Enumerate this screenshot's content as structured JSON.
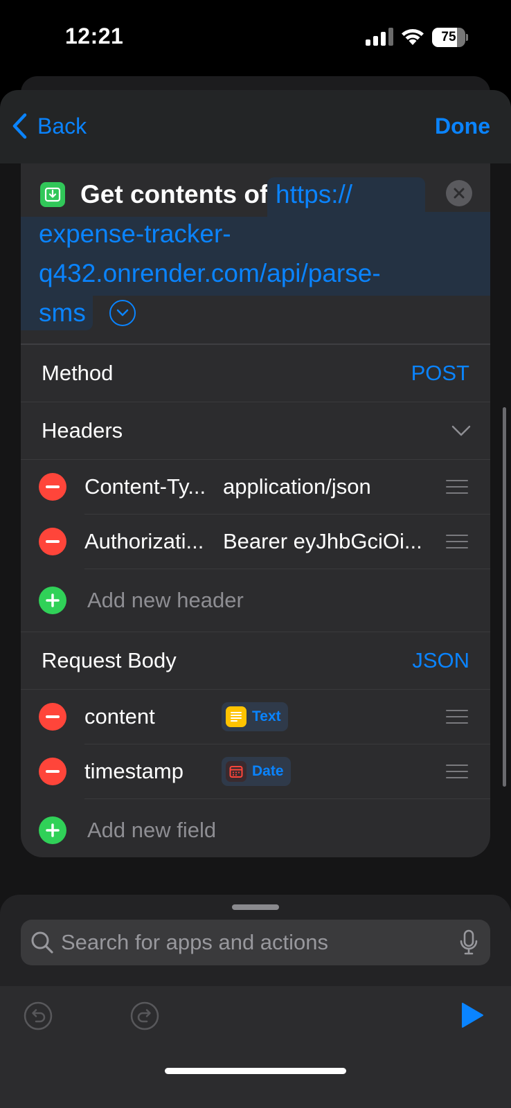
{
  "status_bar": {
    "time": "12:21",
    "battery_level": "75"
  },
  "nav": {
    "back_label": "Back",
    "done_label": "Done"
  },
  "action": {
    "title": "Get contents of",
    "url_lines": [
      "https://",
      "expense-tracker-",
      "q432.onrender.com/api/parse-",
      "sms"
    ]
  },
  "method": {
    "label": "Method",
    "value": "POST"
  },
  "headers": {
    "label": "Headers",
    "items": [
      {
        "key": "Content-Ty...",
        "value": "application/json"
      },
      {
        "key": "Authorizati...",
        "value": "Bearer eyJhbGciOi..."
      }
    ],
    "add_label": "Add new header"
  },
  "request_body": {
    "label": "Request Body",
    "type": "JSON",
    "fields": [
      {
        "key": "content",
        "variable": "Text",
        "variable_icon": "text-variable-icon",
        "icon_color": "#ffc300"
      },
      {
        "key": "timestamp",
        "variable": "Date",
        "variable_icon": "calendar-icon",
        "icon_color": "#ff453a"
      }
    ],
    "add_label": "Add new field"
  },
  "search": {
    "placeholder": "Search for apps and actions"
  },
  "colors": {
    "accent": "#0a84ff",
    "remove": "#ff453a",
    "add": "#30d158",
    "action_icon": "#31c759"
  }
}
